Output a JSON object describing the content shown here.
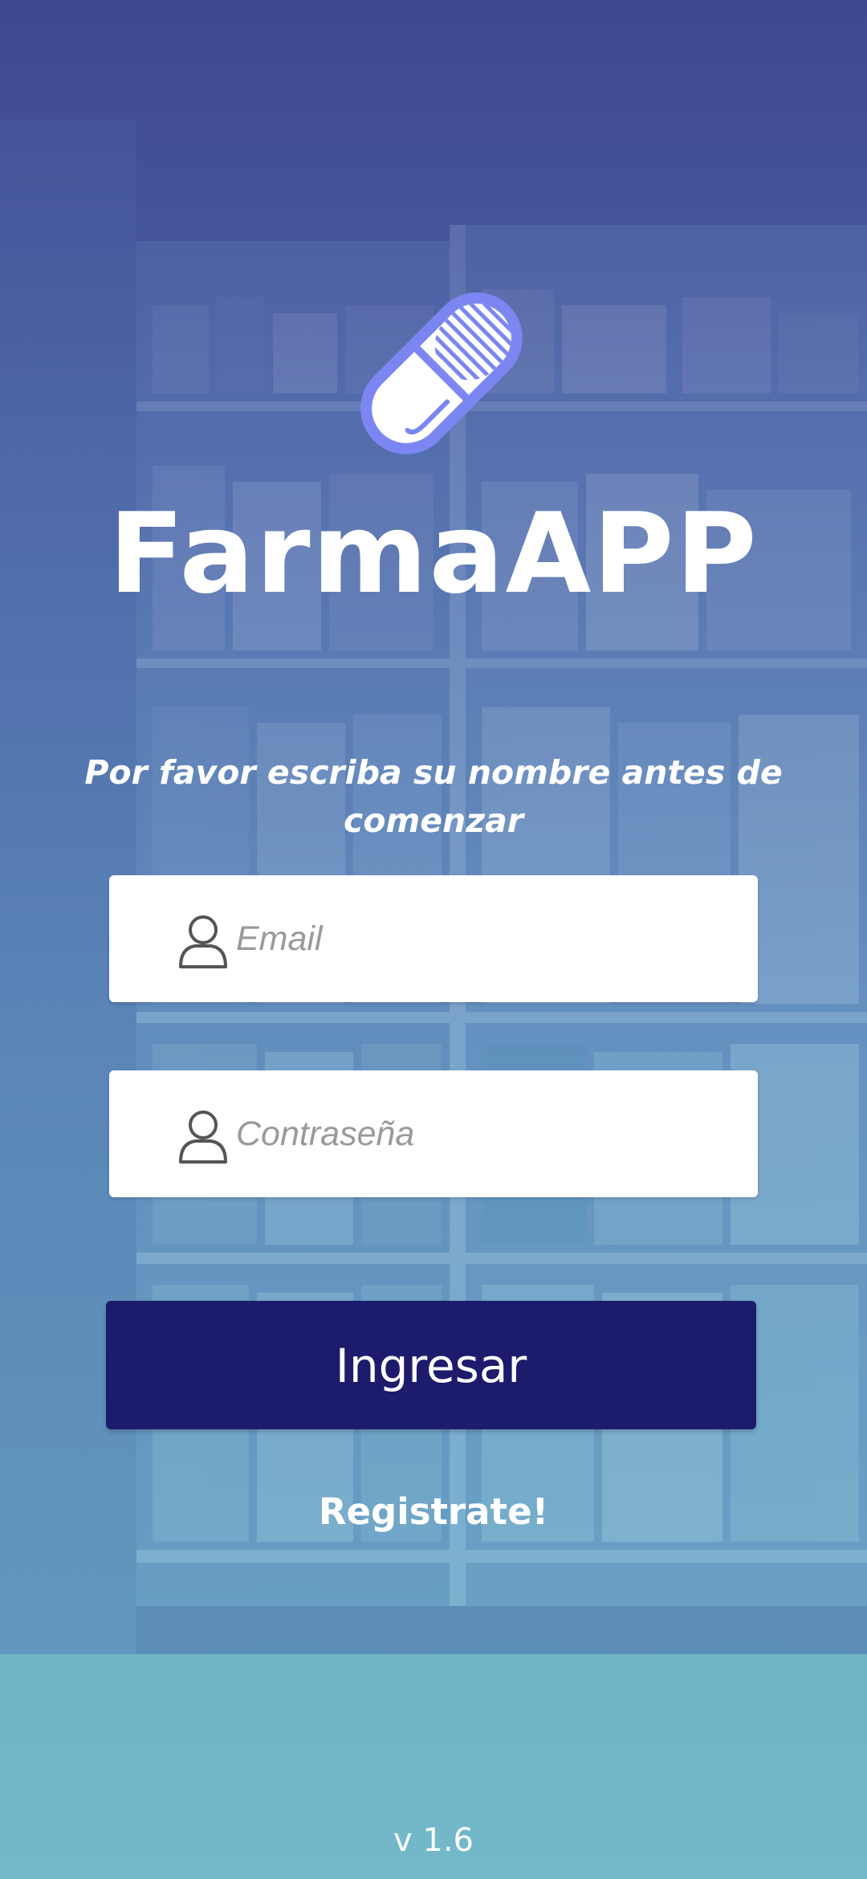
{
  "app": {
    "title": "FarmaAPP",
    "subtitle": "Por favor escriba su nombre antes de comenzar",
    "version": "v 1.6"
  },
  "form": {
    "email_placeholder": "Email",
    "password_placeholder": "Contraseña",
    "login_label": "Ingresar",
    "register_label": "Registrate!"
  },
  "icons": {
    "logo": "pill-capsule-icon",
    "email": "user-icon",
    "password": "user-icon"
  },
  "colors": {
    "primary_button": "#1d1b6b",
    "logo_blue": "#7b86f2",
    "text_light": "#ffffff",
    "placeholder": "#9a9a9a"
  }
}
